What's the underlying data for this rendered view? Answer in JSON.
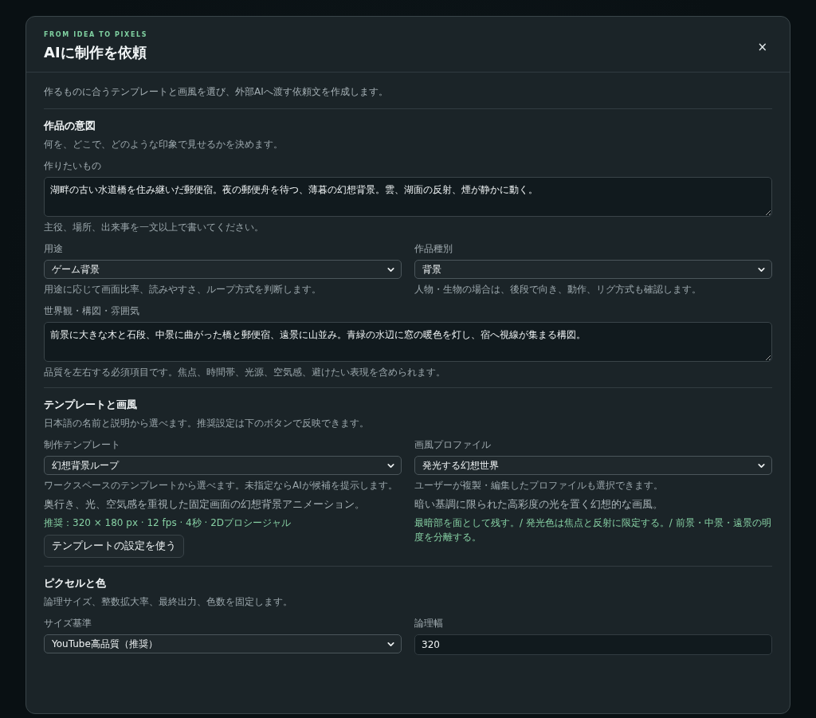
{
  "dialog": {
    "eyebrow": "FROM IDEA TO PIXELS",
    "title": "AIに制作を依頼",
    "close_label": "×",
    "intro": "作るものに合うテンプレートと画風を選び、外部AIへ渡す依頼文を作成します。"
  },
  "sections": [
    {
      "title": "作品の意図",
      "description": "何を、どこで、どのような印象で見せるかを決めます。",
      "fields": [
        {
          "kind": "textarea",
          "label": "作りたいもの",
          "value": "湖畔の古い水道橋を住み継いだ郵便宿。夜の郵便舟を待つ、薄暮の幻想背景。雲、湖面の反射、煙が静かに動く。",
          "hint": "主役、場所、出来事を一文以上で書いてください。"
        },
        {
          "kind": "select",
          "label": "用途",
          "value": "ゲーム背景",
          "hint": "用途に応じて画面比率、読みやすさ、ループ方式を判断します。"
        },
        {
          "kind": "select",
          "label": "作品種別",
          "value": "背景",
          "hint": "人物・生物の場合は、後段で向き、動作、リグ方式も確認します。"
        },
        {
          "kind": "textarea",
          "label": "世界観・構図・雰囲気",
          "value": "前景に大きな木と石段、中景に曲がった橋と郵便宿、遠景に山並み。青緑の水辺に窓の暖色を灯し、宿へ視線が集まる構図。",
          "hint": "品質を左右する必須項目です。焦点、時間帯、光源、空気感、避けたい表現を含められます。"
        }
      ]
    },
    {
      "title": "テンプレートと画風",
      "description": "日本語の名前と説明から選べます。推奨設定は下のボタンで反映できます。",
      "fields": [
        {
          "kind": "select",
          "label": "制作テンプレート",
          "value": "幻想背景ループ",
          "hint": "ワークスペースのテンプレートから選べます。未指定ならAIが候補を提示します。",
          "detail": "奥行き、光、空気感を重視した固定画面の幻想背景アニメーション。",
          "note": "推奨：320 × 180 px · 12 fps · 4秒 · 2Dプロシージャル",
          "action": "テンプレートの設定を使う"
        },
        {
          "kind": "select",
          "label": "画風プロファイル",
          "value": "発光する幻想世界",
          "hint": "ユーザーが複製・編集したプロファイルも選択できます。",
          "detail": "暗い基調に限られた高彩度の光を置く幻想的な画風。",
          "note": "最暗部を面として残す。/ 発光色は焦点と反射に限定する。/ 前景・中景・遠景の明度を分離する。"
        }
      ]
    },
    {
      "title": "ピクセルと色",
      "description": "論理サイズ、整数拡大率、最終出力、色数を固定します。",
      "fields": [
        {
          "kind": "select",
          "label": "サイズ基準",
          "value": "YouTube高品質（推奨）"
        },
        {
          "kind": "input",
          "label": "論理幅",
          "value": "320"
        }
      ]
    }
  ]
}
